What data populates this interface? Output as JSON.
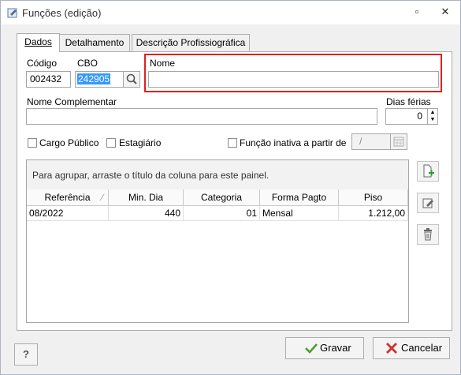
{
  "window": {
    "title": "Funções (edição)"
  },
  "tabs": [
    {
      "label": "Dados"
    },
    {
      "label": "Detalhamento"
    },
    {
      "label": "Descrição Profissiográfica"
    }
  ],
  "form": {
    "codigo_label": "Código",
    "codigo_value": "002432",
    "cbo_label": "CBO",
    "cbo_value": "242905",
    "nome_label": "Nome",
    "nome_value": "",
    "nome_complementar_label": "Nome Complementar",
    "nome_complementar_value": "",
    "dias_ferias_label": "Dias férias",
    "dias_ferias_value": "0",
    "cargo_publico_label": "Cargo Público",
    "estagiario_label": "Estagiário",
    "funcao_inativa_label": "Função inativa a partir de",
    "funcao_inativa_date": "/"
  },
  "grid": {
    "group_hint": "Para agrupar, arraste o título da coluna para este painel.",
    "columns": [
      "Referência",
      "Min. Dia",
      "Categoria",
      "Forma Pagto",
      "Piso"
    ],
    "rows": [
      [
        "08/2022",
        "440",
        "01",
        "Mensal",
        "1.212,00"
      ]
    ]
  },
  "footer": {
    "help_label": "?",
    "gravar_label": "Gravar",
    "cancelar_label": "Cancelar"
  },
  "colors": {
    "highlight": "#e02020",
    "selection": "#3399ff"
  }
}
